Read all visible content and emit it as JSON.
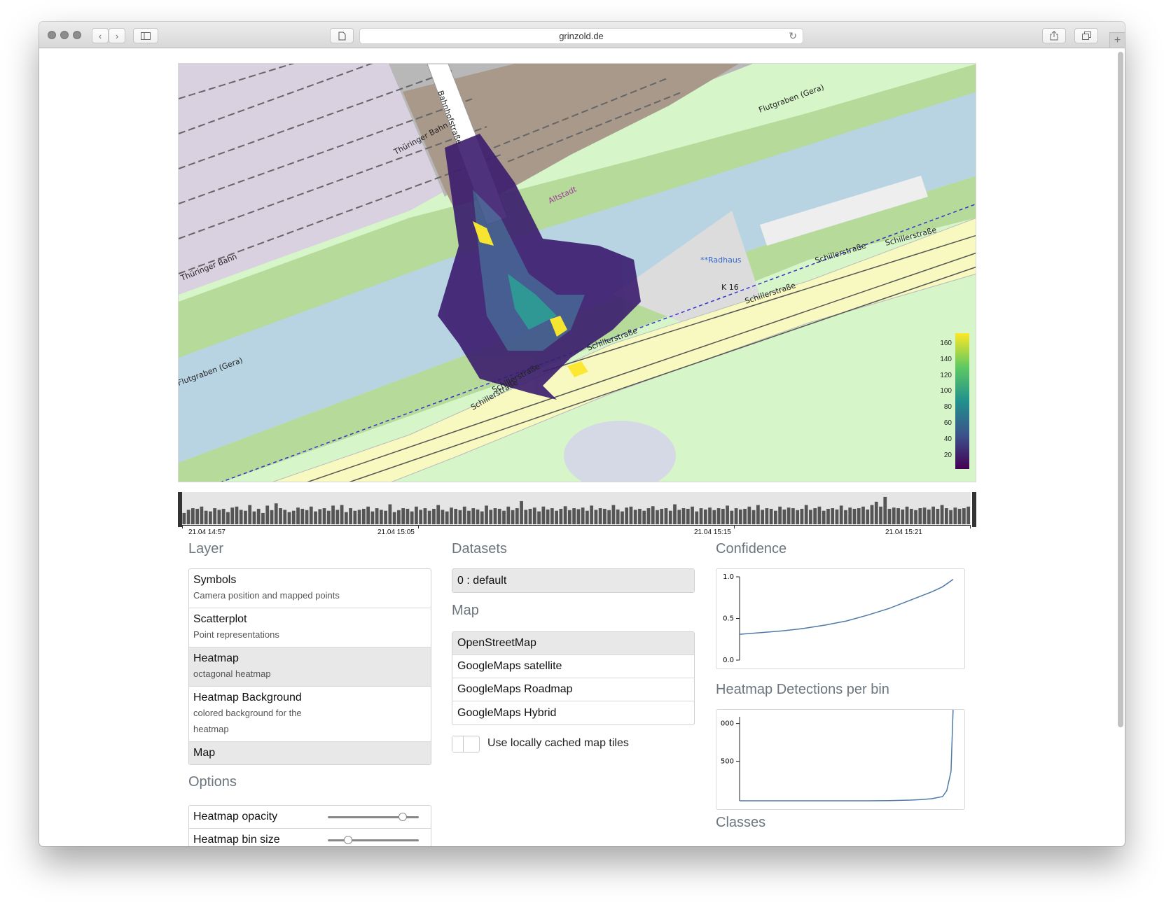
{
  "browser": {
    "url": "grinzold.de"
  },
  "map": {
    "colorbar_labels": [
      "160",
      "140",
      "120",
      "100",
      "80",
      "60",
      "40",
      "20"
    ],
    "street_labels": [
      "Schillerstraße",
      "Schillerstraße",
      "Schillerstraße",
      "Schillerstraße",
      "Schillerstraße",
      "Schillerstraße",
      "K 16",
      "Thüringer Bahn",
      "Thüringer Bahn",
      "Flutgraben (Gera)",
      "Flutgraben (Gera)",
      "Altstadt",
      "**Radhaus",
      "Bahnhofstraße"
    ]
  },
  "timeline": {
    "labels": [
      "21.04 14:57",
      "21.04 15:05",
      "21.04 15:15",
      "21.04 15:21"
    ],
    "bar_values": [
      0.35,
      0.45,
      0.5,
      0.48,
      0.55,
      0.42,
      0.4,
      0.5,
      0.45,
      0.48,
      0.38,
      0.52,
      0.55,
      0.45,
      0.42,
      0.6,
      0.4,
      0.48,
      0.35,
      0.58,
      0.44,
      0.65,
      0.5,
      0.45,
      0.38,
      0.42,
      0.52,
      0.48,
      0.44,
      0.55,
      0.4,
      0.47,
      0.5,
      0.42,
      0.58,
      0.45,
      0.6,
      0.38,
      0.5,
      0.42,
      0.45,
      0.48,
      0.55,
      0.4,
      0.5,
      0.45,
      0.42,
      0.62,
      0.38,
      0.44,
      0.5,
      0.48,
      0.4,
      0.55,
      0.45,
      0.5,
      0.42,
      0.48,
      0.6,
      0.45,
      0.4,
      0.52,
      0.48,
      0.44,
      0.55,
      0.42,
      0.5,
      0.46,
      0.4,
      0.58,
      0.45,
      0.5,
      0.48,
      0.42,
      0.55,
      0.44,
      0.5,
      0.72,
      0.45,
      0.48,
      0.52,
      0.4,
      0.55,
      0.46,
      0.5,
      0.42,
      0.48,
      0.56,
      0.44,
      0.5,
      0.47,
      0.52,
      0.42,
      0.58,
      0.45,
      0.5,
      0.48,
      0.44,
      0.6,
      0.46,
      0.4,
      0.52,
      0.55,
      0.45,
      0.48,
      0.42,
      0.5,
      0.56,
      0.44,
      0.48,
      0.5,
      0.42,
      0.62,
      0.45,
      0.5,
      0.48,
      0.55,
      0.4,
      0.5,
      0.46,
      0.52,
      0.44,
      0.5,
      0.48,
      0.58,
      0.42,
      0.5,
      0.46,
      0.48,
      0.55,
      0.44,
      0.6,
      0.45,
      0.5,
      0.48,
      0.42,
      0.55,
      0.46,
      0.52,
      0.5,
      0.44,
      0.48,
      0.6,
      0.45,
      0.5,
      0.55,
      0.42,
      0.48,
      0.5,
      0.46,
      0.58,
      0.44,
      0.52,
      0.48,
      0.5,
      0.55,
      0.46,
      0.6,
      0.7,
      0.55,
      0.85,
      0.48,
      0.52,
      0.5,
      0.46,
      0.55,
      0.48,
      0.44,
      0.5,
      0.52,
      0.46,
      0.55,
      0.48,
      0.6,
      0.5,
      0.44,
      0.52,
      0.48,
      0.5,
      0.55
    ]
  },
  "layer": {
    "title": "Layer",
    "items": [
      {
        "title": "Symbols",
        "subtitle": "Camera position and mapped points",
        "active": false
      },
      {
        "title": "Scatterplot",
        "subtitle": "Point representations",
        "active": false
      },
      {
        "title": "Heatmap",
        "subtitle": "octagonal heatmap",
        "active": true
      },
      {
        "title": "Heatmap Background",
        "subtitle": "colored background for the heatmap",
        "active": false
      },
      {
        "title": "Map",
        "subtitle": "",
        "active": true
      }
    ]
  },
  "options": {
    "title": "Options",
    "rows": [
      {
        "label": "Heatmap opacity",
        "value": 0.82
      },
      {
        "label": "Heatmap bin size",
        "value": 0.22
      }
    ]
  },
  "datasets": {
    "title": "Datasets",
    "items": [
      "0 : default"
    ]
  },
  "map_panel": {
    "title": "Map",
    "items": [
      "OpenStreetMap",
      "GoogleMaps satellite",
      "GoogleMaps Roadmap",
      "GoogleMaps Hybrid"
    ],
    "selected": "OpenStreetMap",
    "toggle_label": "Use locally cached map tiles",
    "toggle_on": false
  },
  "confidence": {
    "title": "Confidence",
    "chart_data": {
      "type": "line",
      "x": [
        0,
        0.1,
        0.2,
        0.3,
        0.4,
        0.5,
        0.6,
        0.7,
        0.8,
        0.9,
        0.95,
        1.0
      ],
      "values": [
        0.31,
        0.33,
        0.35,
        0.38,
        0.42,
        0.47,
        0.54,
        0.62,
        0.72,
        0.82,
        0.88,
        0.97
      ],
      "yticks": [
        "1.0",
        "0.5",
        "0.0"
      ],
      "ylim": [
        0,
        1
      ]
    }
  },
  "detections": {
    "title": "Heatmap Detections per bin",
    "chart_data": {
      "type": "line",
      "x": [
        0,
        0.1,
        0.2,
        0.3,
        0.4,
        0.5,
        0.6,
        0.7,
        0.8,
        0.85,
        0.9,
        0.95,
        0.97,
        0.99,
        1.0
      ],
      "values": [
        0,
        0,
        0,
        0,
        0,
        0,
        0,
        2,
        8,
        15,
        25,
        50,
        120,
        350,
        1120
      ],
      "yticks": [
        "000",
        "500"
      ],
      "ylim": [
        0,
        1000
      ]
    }
  },
  "classes": {
    "title": "Classes"
  }
}
